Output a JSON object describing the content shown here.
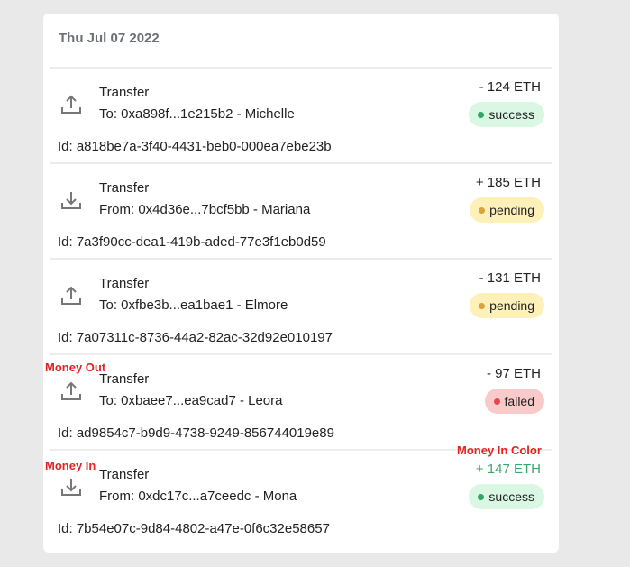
{
  "date": "Thu Jul 07 2022",
  "transactions": [
    {
      "type": "Transfer",
      "party": "To: 0xa898f...1e215b2 - Michelle",
      "amount": "- 124 ETH",
      "status": "success",
      "id": "Id: a818be7a-3f40-4431-beb0-000ea7ebe23b",
      "direction": "out"
    },
    {
      "type": "Transfer",
      "party": "From: 0x4d36e...7bcf5bb - Mariana",
      "amount": "+ 185 ETH",
      "status": "pending",
      "id": "Id: 7a3f90cc-dea1-419b-aded-77e3f1eb0d59",
      "direction": "in"
    },
    {
      "type": "Transfer",
      "party": "To: 0xfbe3b...ea1bae1 - Elmore",
      "amount": "- 131 ETH",
      "status": "pending",
      "id": "Id: 7a07311c-8736-44a2-82ac-32d92e010197",
      "direction": "out"
    },
    {
      "type": "Transfer",
      "party": "To: 0xbaee7...ea9cad7 - Leora",
      "amount": "- 97 ETH",
      "status": "failed",
      "id": "Id: ad9854c7-b9d9-4738-9249-856744019e89",
      "direction": "out"
    },
    {
      "type": "Transfer",
      "party": "From: 0xdc17c...a7ceedc - Mona",
      "amount": "+ 147 ETH",
      "status": "success",
      "id": "Id: 7b54e07c-9d84-4802-a47e-0f6c32e58657",
      "direction": "in",
      "amount_color": "#3aa76d"
    }
  ],
  "annotations": {
    "money_out": "Money Out",
    "money_in": "Money In",
    "money_in_color": "Money In Color"
  },
  "colors": {
    "money_in": "#3aa76d",
    "success": "#2fa866",
    "pending": "#d9a23a",
    "failed": "#e0484d",
    "annotation": "#e02424"
  }
}
